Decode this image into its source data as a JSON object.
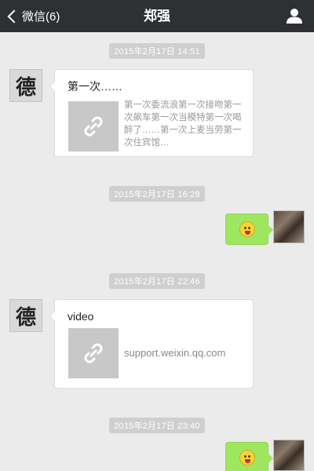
{
  "header": {
    "back_label": "微信(6)",
    "title": "郑强",
    "icons": {
      "back": "chevron-left-icon",
      "profile": "person-icon"
    },
    "background": "#2e3034"
  },
  "messages": [
    {
      "type": "timestamp",
      "text": "2015年2月17日 14:51"
    },
    {
      "type": "link",
      "sender": "contact",
      "avatar_text": "德",
      "title": "第一次……",
      "description": "第一次委流浪第一次接吻第一次飙车第一次当模特第一次喝醉了……第一次上麦当劳第一次住宾馆…",
      "icon": "link-icon"
    },
    {
      "type": "timestamp",
      "text": "2015年2月17日 16:28"
    },
    {
      "type": "emoji",
      "sender": "me",
      "icon": "emoji-face-icon"
    },
    {
      "type": "timestamp",
      "text": "2015年2月17日 22:46"
    },
    {
      "type": "link",
      "sender": "contact",
      "avatar_text": "德",
      "title": "video",
      "description": "support.weixin.qq.com",
      "icon": "link-icon"
    },
    {
      "type": "timestamp",
      "text": "2015年2月17日 23:40"
    },
    {
      "type": "emoji",
      "sender": "me",
      "icon": "emoji-face-icon"
    }
  ],
  "colors": {
    "own_bubble": "#9ee65f",
    "chat_background": "#ebebeb",
    "timestamp_pill": "#cfcfcf"
  }
}
